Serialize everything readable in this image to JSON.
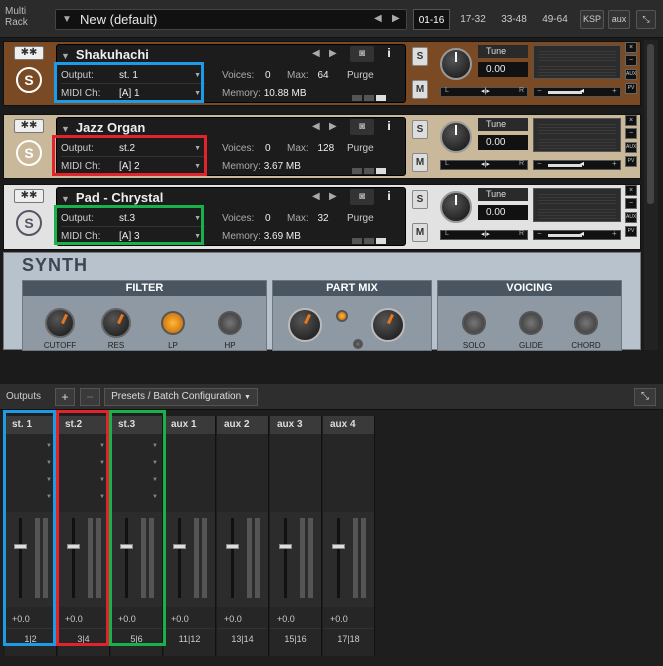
{
  "app": {
    "label": "Multi Rack"
  },
  "rack": {
    "preset_name": "New (default)",
    "ranges": [
      "01-16",
      "17-32",
      "33-48",
      "49-64"
    ],
    "ksp": "KSP",
    "aux": "aux"
  },
  "instruments": [
    {
      "name": "Shakuhachi",
      "output_label": "Output:",
      "output": "st. 1",
      "midi_label": "MIDI Ch:",
      "midi": "[A]  1",
      "voices_label": "Voices:",
      "voices": "0",
      "max_label": "Max:",
      "max": "64",
      "purge": "Purge",
      "memory_label": "Memory:",
      "memory": "10.88 MB",
      "tune_label": "Tune",
      "tune": "0.00"
    },
    {
      "name": "Jazz Organ",
      "output_label": "Output:",
      "output": "st.2",
      "midi_label": "MIDI Ch:",
      "midi": "[A]  2",
      "voices_label": "Voices:",
      "voices": "0",
      "max_label": "Max:",
      "max": "128",
      "purge": "Purge",
      "memory_label": "Memory:",
      "memory": "3.67 MB",
      "tune_label": "Tune",
      "tune": "0.00"
    },
    {
      "name": "Pad - Chrystal",
      "output_label": "Output:",
      "output": "st.3",
      "midi_label": "MIDI Ch:",
      "midi": "[A]  3",
      "voices_label": "Voices:",
      "voices": "0",
      "max_label": "Max:",
      "max": "32",
      "purge": "Purge",
      "memory_label": "Memory:",
      "memory": "3.69 MB",
      "tune_label": "Tune",
      "tune": "0.00"
    }
  ],
  "synth": {
    "title": "SYNTH",
    "sections": [
      {
        "title": "FILTER",
        "controls": [
          "CUTOFF",
          "RES",
          "LP",
          "HP"
        ]
      },
      {
        "title": "PART MIX",
        "controls": []
      },
      {
        "title": "VOICING",
        "controls": [
          "SOLO",
          "GLIDE",
          "CHORD"
        ]
      }
    ]
  },
  "outputs": {
    "label": "Outputs",
    "plus": "+",
    "minus": "−",
    "presets": "Presets / Batch Configuration",
    "channels": [
      {
        "name": "st. 1",
        "db": "+0.0",
        "io": "1|2"
      },
      {
        "name": "st.2",
        "db": "+0.0",
        "io": "3|4"
      },
      {
        "name": "st.3",
        "db": "+0.0",
        "io": "5|6"
      },
      {
        "name": "aux 1",
        "db": "+0.0",
        "io": "11|12"
      },
      {
        "name": "aux 2",
        "db": "+0.0",
        "io": "13|14"
      },
      {
        "name": "aux 3",
        "db": "+0.0",
        "io": "15|16"
      },
      {
        "name": "aux 4",
        "db": "+0.0",
        "io": "17|18"
      }
    ]
  },
  "highlights": {
    "blue": "#1e9be8",
    "red": "#e0242a",
    "green": "#19b14a"
  },
  "colors": {
    "inst1": "#7a4a24",
    "inst2": "#c9b99a",
    "inst3": "#e2e2e2"
  }
}
